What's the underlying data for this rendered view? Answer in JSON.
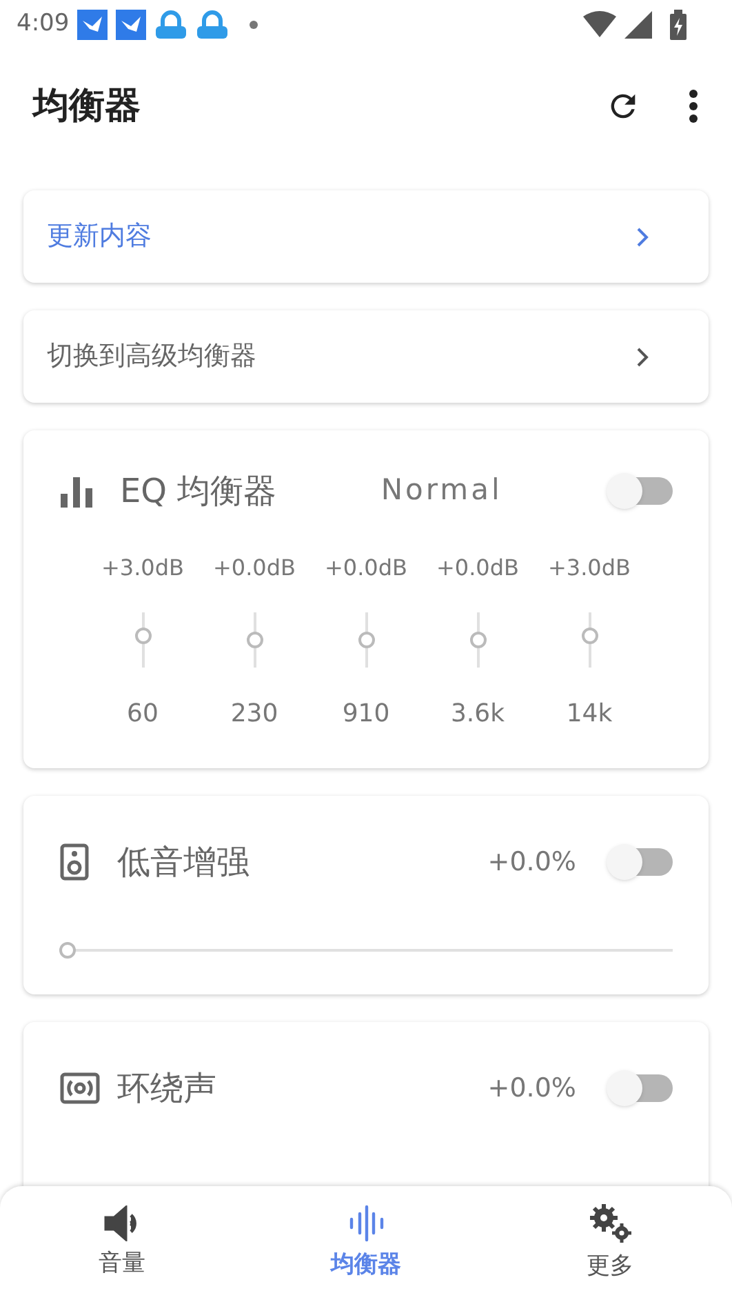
{
  "status_bar": {
    "time": "4:09"
  },
  "app_bar": {
    "title": "均衡器"
  },
  "links": [
    {
      "label": "更新内容",
      "highlighted": true
    },
    {
      "label": "切换到高级均衡器",
      "highlighted": false
    }
  ],
  "eq": {
    "title": "EQ 均衡器",
    "preset": "Normal",
    "on": false,
    "bands": [
      {
        "gain": "+3.0dB",
        "level": 0.6,
        "freq": "60"
      },
      {
        "gain": "+0.0dB",
        "level": 0.5,
        "freq": "230"
      },
      {
        "gain": "+0.0dB",
        "level": 0.5,
        "freq": "910"
      },
      {
        "gain": "+0.0dB",
        "level": 0.5,
        "freq": "3.6k"
      },
      {
        "gain": "+3.0dB",
        "level": 0.6,
        "freq": "14k"
      }
    ]
  },
  "effects": [
    {
      "kind": "bass",
      "title": "低音增强",
      "reading": "+0.0%",
      "on": false,
      "level": 0
    },
    {
      "kind": "surround",
      "title": "环绕声",
      "reading": "+0.0%",
      "on": false
    }
  ],
  "bottom_nav": [
    {
      "kind": "volume",
      "label": "音量",
      "selected": false
    },
    {
      "kind": "equalizer",
      "label": "均衡器",
      "selected": true
    },
    {
      "kind": "more",
      "label": "更多",
      "selected": false
    }
  ]
}
